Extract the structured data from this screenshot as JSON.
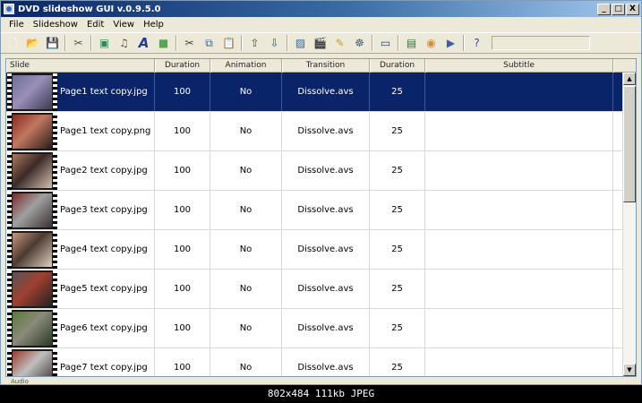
{
  "window": {
    "title": "DVD slideshow GUI v.0.9.5.0",
    "minimize": "_",
    "restore": "□",
    "close": "X"
  },
  "menu": [
    "File",
    "Slideshow",
    "Edit",
    "View",
    "Help"
  ],
  "toolbar": {
    "icons": [
      {
        "name": "new-file-icon",
        "glyph": "🗋",
        "color": "#ffffff"
      },
      {
        "name": "open-folder-icon",
        "glyph": "📂",
        "color": "#d9a520"
      },
      {
        "name": "save-icon",
        "glyph": "💾",
        "color": "#2b4fa0"
      },
      {
        "sep": true
      },
      {
        "name": "tools-icon",
        "glyph": "✂",
        "color": "#555555"
      },
      {
        "sep": true
      },
      {
        "name": "add-image-icon",
        "glyph": "▣",
        "color": "#2e8b57"
      },
      {
        "name": "add-audio-icon",
        "glyph": "♫",
        "color": "#555555"
      },
      {
        "name": "text-icon",
        "glyph": "A",
        "color": "#1f3a93"
      },
      {
        "name": "background-icon",
        "glyph": "■",
        "color": "#5aa45a"
      },
      {
        "sep": true
      },
      {
        "name": "cut-icon",
        "glyph": "✂",
        "color": "#444444"
      },
      {
        "name": "copy-icon",
        "glyph": "⧉",
        "color": "#3366aa"
      },
      {
        "name": "paste-icon",
        "glyph": "📋",
        "color": "#c08a2a"
      },
      {
        "sep": true
      },
      {
        "name": "move-up-icon",
        "glyph": "⇧",
        "color": "#2255aa"
      },
      {
        "name": "move-down-icon",
        "glyph": "⇩",
        "color": "#2255aa"
      },
      {
        "sep": true
      },
      {
        "name": "image-edit-icon",
        "glyph": "▨",
        "color": "#2a6aa8"
      },
      {
        "name": "clapper-icon",
        "glyph": "🎬",
        "color": "#333333"
      },
      {
        "name": "brush-icon",
        "glyph": "✎",
        "color": "#c0a020"
      },
      {
        "name": "dvd-wizard-icon",
        "glyph": "☸",
        "color": "#556677"
      },
      {
        "sep": true
      },
      {
        "name": "presentation-icon",
        "glyph": "▭",
        "color": "#334477"
      },
      {
        "sep": true
      },
      {
        "name": "export-icon",
        "glyph": "▤",
        "color": "#2a7a3a"
      },
      {
        "name": "disc-icon",
        "glyph": "◉",
        "color": "#d98c2a"
      },
      {
        "name": "youtube-icon",
        "glyph": "▶",
        "color": "#3a5fa8"
      },
      {
        "sep": true
      },
      {
        "name": "help-icon",
        "glyph": "?",
        "color": "#2a4fa8"
      }
    ]
  },
  "table": {
    "headers": [
      "Slide",
      "Duration",
      "Animation",
      "Transition",
      "Duration",
      "Subtitle"
    ],
    "rows": [
      {
        "name": "Page1 text copy.jpg",
        "duration": "100",
        "animation": "No",
        "transition": "Dissolve.avs",
        "transition_duration": "25",
        "subtitle": "",
        "selected": true,
        "thumb_colors": [
          "#6b6f9a",
          "#9a8fb8",
          "#3a3a55"
        ]
      },
      {
        "name": "Page1 text copy.png",
        "duration": "100",
        "animation": "No",
        "transition": "Dissolve.avs",
        "transition_duration": "25",
        "subtitle": "",
        "selected": false,
        "thumb_colors": [
          "#8a2a22",
          "#c07860",
          "#2a1a18"
        ]
      },
      {
        "name": "Page2 text copy.jpg",
        "duration": "100",
        "animation": "No",
        "transition": "Dissolve.avs",
        "transition_duration": "25",
        "subtitle": "",
        "selected": false,
        "thumb_colors": [
          "#b07a62",
          "#3a2a26",
          "#d8c0b0"
        ]
      },
      {
        "name": "Page3 text copy.jpg",
        "duration": "100",
        "animation": "No",
        "transition": "Dissolve.avs",
        "transition_duration": "25",
        "subtitle": "",
        "selected": false,
        "thumb_colors": [
          "#7a2a2a",
          "#a0a0a0",
          "#3a3030"
        ]
      },
      {
        "name": "Page4 text copy.jpg",
        "duration": "100",
        "animation": "No",
        "transition": "Dissolve.avs",
        "transition_duration": "25",
        "subtitle": "",
        "selected": false,
        "thumb_colors": [
          "#c89880",
          "#4a3a30",
          "#e0d0c0"
        ]
      },
      {
        "name": "Page5 text copy.jpg",
        "duration": "100",
        "animation": "No",
        "transition": "Dissolve.avs",
        "transition_duration": "25",
        "subtitle": "",
        "selected": false,
        "thumb_colors": [
          "#555555",
          "#a04030",
          "#222222"
        ]
      },
      {
        "name": "Page6 text copy.jpg",
        "duration": "100",
        "animation": "No",
        "transition": "Dissolve.avs",
        "transition_duration": "25",
        "subtitle": "",
        "selected": false,
        "thumb_colors": [
          "#5a7a3a",
          "#8a8a7a",
          "#2a3a22"
        ]
      },
      {
        "name": "Page7 text copy.jpg",
        "duration": "100",
        "animation": "No",
        "transition": "Dissolve.avs",
        "transition_duration": "25",
        "subtitle": "",
        "selected": false,
        "thumb_colors": [
          "#9a3a2a",
          "#c0c0c0",
          "#3a2a2a"
        ]
      }
    ]
  },
  "audio_label": "Audio",
  "caption": "802x484  111kb  JPEG",
  "colors": {
    "selection": "#0a246a",
    "window": "#ece9d8"
  }
}
